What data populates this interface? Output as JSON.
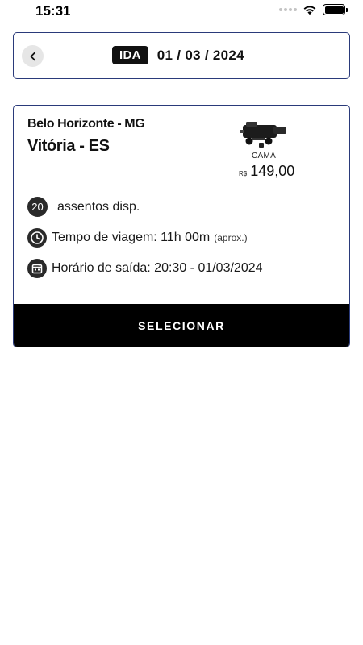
{
  "status_bar": {
    "time": "15:31",
    "icons": [
      "cellular-signal-icon",
      "wifi-icon",
      "battery-icon"
    ]
  },
  "header": {
    "back_icon": "chevron-left-icon",
    "trip_badge": "IDA",
    "date": "01 / 03 / 2024"
  },
  "trip": {
    "origin": "Belo Horizonte - MG",
    "destination": "Vitória - ES",
    "image": "bus-icon",
    "seat_type": "CAMA",
    "currency": "R$",
    "price": "149,00",
    "seats_available": "20",
    "seats_label": "assentos disp.",
    "travel_time_label": "Tempo de viagem: 11h 00m",
    "travel_time_note": "(aprox.)",
    "departure_label": "Horário de saída: 20:30 - 01/03/2024",
    "select_button": "SELECIONAR"
  },
  "colors": {
    "border": "#2a3a7a",
    "button_bg": "#000000",
    "badge_bg": "#111111"
  }
}
